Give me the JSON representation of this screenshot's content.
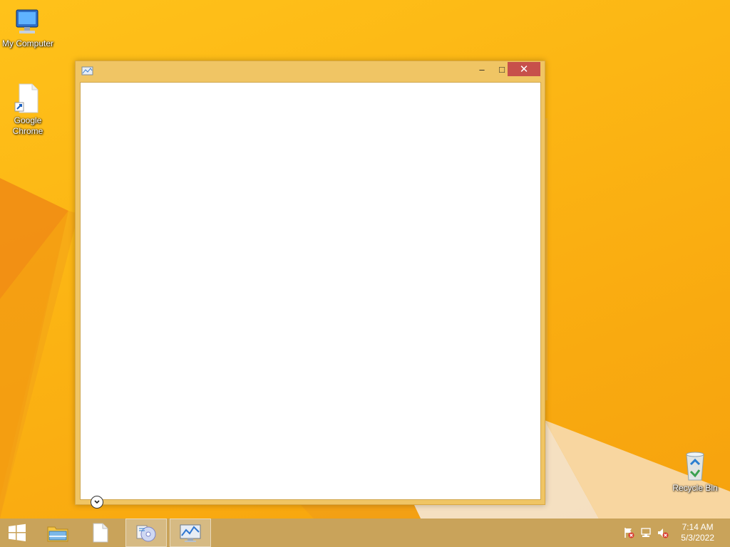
{
  "desktop": {
    "icons": [
      {
        "label": "My Computer",
        "icon": "computer-icon"
      },
      {
        "label": "Google Chrome",
        "icon": "shortcut-file-icon"
      },
      {
        "label": "Recycle Bin",
        "icon": "recycle-bin-icon"
      }
    ]
  },
  "window": {
    "title": "",
    "icon": "app-icon",
    "controls": {
      "minimize": "–",
      "maximize": "□",
      "close": "✕"
    },
    "expand_icon": "chevron-down-icon"
  },
  "taskbar": {
    "items": [
      {
        "icon": "start-icon"
      },
      {
        "icon": "file-explorer-icon"
      },
      {
        "icon": "blank-file-icon"
      },
      {
        "icon": "media-app-icon"
      },
      {
        "icon": "performance-monitor-icon"
      }
    ],
    "tray": [
      {
        "icon": "action-center-flag-icon"
      },
      {
        "icon": "network-icon"
      },
      {
        "icon": "volume-muted-icon"
      }
    ],
    "clock": {
      "time": "7:14 AM",
      "date": "5/3/2022"
    }
  },
  "colors": {
    "wallpaper": "#fcb614",
    "window_frame": "#f0c564",
    "close_button": "#c7504b",
    "taskbar": "#c9a35a"
  }
}
